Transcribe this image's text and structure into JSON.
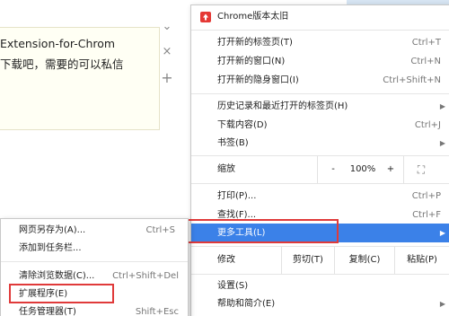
{
  "tip": {
    "line1": "Extension-for-Chrom",
    "line2": "下载吧，需要的可以私信"
  },
  "side_icons": {
    "chevron": "⌄",
    "close": "×",
    "add": "+"
  },
  "main_menu": {
    "header_label": "Chrome版本太旧",
    "new_tab": "打开新的标签页(T)",
    "new_tab_sc": "Ctrl+T",
    "new_window": "打开新的窗口(N)",
    "new_window_sc": "Ctrl+N",
    "incognito": "打开新的隐身窗口(I)",
    "incognito_sc": "Ctrl+Shift+N",
    "history": "历史记录和最近打开的标签页(H)",
    "downloads": "下载内容(D)",
    "downloads_sc": "Ctrl+J",
    "bookmarks": "书签(B)",
    "zoom": "缩放",
    "zoom_minus": "-",
    "zoom_value": "100%",
    "zoom_plus": "+",
    "fullscreen": "⛶",
    "print": "打印(P)...",
    "print_sc": "Ctrl+P",
    "find": "查找(F)...",
    "find_sc": "Ctrl+F",
    "more_tools": "更多工具(L)",
    "edit": "修改",
    "cut": "剪切(T)",
    "copy": "复制(C)",
    "paste": "粘贴(P)",
    "settings": "设置(S)",
    "help": "帮助和简介(E)"
  },
  "sub_menu": {
    "save_as": "网页另存为(A)...",
    "save_as_sc": "Ctrl+S",
    "add_taskbar": "添加到任务栏...",
    "clear_data": "清除浏览数据(C)...",
    "clear_data_sc": "Ctrl+Shift+Del",
    "extensions": "扩展程序(E)",
    "task_manager": "任务管理器(T)",
    "task_manager_sc": "Shift+Esc"
  },
  "colors": {
    "highlight": "#3b81e8",
    "annotation_red": "#e03a3a",
    "warning_icon": "#e53935"
  }
}
